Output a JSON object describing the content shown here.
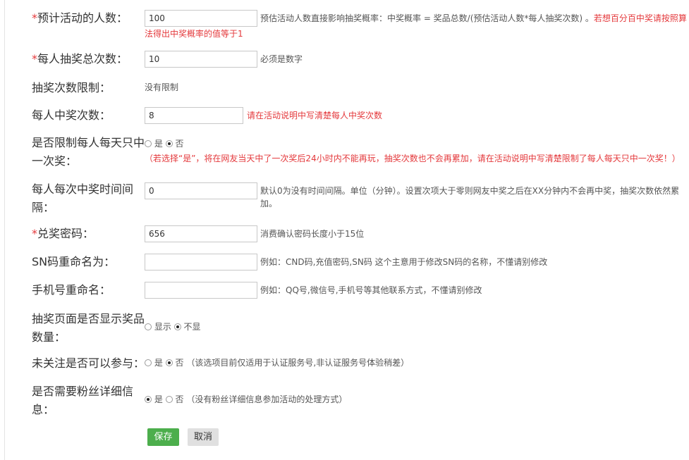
{
  "form": {
    "participants": {
      "required_mark": "*",
      "label": "预计活动的人数：",
      "value": "100",
      "hint": "预估活动人数直接影响抽奖概率：中奖概率 = 奖品总数/(预估活动人数*每人抽奖次数) 。",
      "warn_line1": "若想百分百中奖请按照算",
      "warn_line2": "法得出中奖概率的值等于1"
    },
    "draws_per_person": {
      "required_mark": "*",
      "label": "每人抽奖总次数：",
      "value": "10",
      "hint": "必须是数字"
    },
    "draw_limit": {
      "label": "抽奖次数限制：",
      "value": "没有限制"
    },
    "wins_per_person": {
      "label": "每人中奖次数：",
      "value": "8",
      "warn": "请在活动说明中写清楚每人中奖次数"
    },
    "daily_limit": {
      "label_line1": "是否限制每人每天只中",
      "label_line2": "一次奖：",
      "yes": "是",
      "no": "否",
      "selected": "否",
      "warn": "（若选择“是”，将在网友当天中了一次奖后24小时内不能再玩，抽奖次数也不会再累加，请在活动说明中写清楚限制了每人每天只中一次奖！）"
    },
    "interval": {
      "label_line1": "每人每次中奖时间间",
      "label_line2": "隔：",
      "value": "0",
      "hint_line1": "默认0为没有时间间隔。单位（分钟）。设置次项大于零则网友中奖之后在XX分钟内不会再中奖，抽奖次数依然累",
      "hint_line2": "加。"
    },
    "redeem_password": {
      "required_mark": "*",
      "label": "兑奖密码：",
      "value": "656",
      "hint": "消费确认密码长度小于15位"
    },
    "sn_rename": {
      "label": "SN码重命名为：",
      "value": "",
      "hint": "例如：CND码,充值密码,SN码 这个主意用于修改SN码的名称，不懂请别修改"
    },
    "phone_rename": {
      "label": "手机号重命名：",
      "value": "",
      "hint": "例如：QQ号,微信号,手机号等其他联系方式，不懂请别修改"
    },
    "show_prize_count": {
      "label_line1": "抽奖页面是否显示奖品",
      "label_line2": "数量：",
      "show": "显示",
      "hide": "不显",
      "selected": "不显"
    },
    "unfollowed": {
      "label": "未关注是否可以参与：",
      "yes": "是",
      "no": "否",
      "selected": "否",
      "hint": "（该选项目前仅适用于认证服务号,非认证服务号体验稍差）"
    },
    "fan_details": {
      "label_line1": "是否需要粉丝详细信",
      "label_line2": "息：",
      "yes": "是",
      "no": "否",
      "selected": "是",
      "hint": "（没有粉丝详细信息参加活动的处理方式）"
    }
  },
  "actions": {
    "save_label": "保存",
    "cancel_label": "取消"
  },
  "colors": {
    "warning": "#e4393c",
    "save_button": "#4cae4c",
    "cancel_button": "#e0e0e0"
  }
}
